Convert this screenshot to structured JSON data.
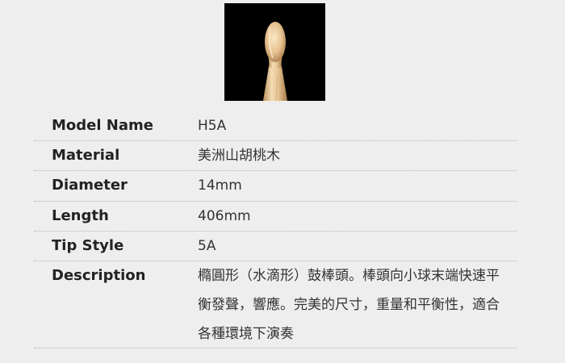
{
  "product_image": {
    "name": "drumstick-tip-photo",
    "background": "#000000",
    "wood_color": "#e9c99a"
  },
  "specs": [
    {
      "label": "Model Name",
      "value": "H5A"
    },
    {
      "label": "Material",
      "value": "美洲山胡桃木"
    },
    {
      "label": "Diameter",
      "value": "14mm"
    },
    {
      "label": "Length",
      "value": "406mm"
    },
    {
      "label": "Tip Style",
      "value": "5A"
    },
    {
      "label": "Description",
      "value": "橢圓形（水滴形）鼓棒頭。棒頭向小球末端快速平衡發聲，響應。完美的尺寸，重量和平衡性，適合各種環境下演奏"
    }
  ]
}
